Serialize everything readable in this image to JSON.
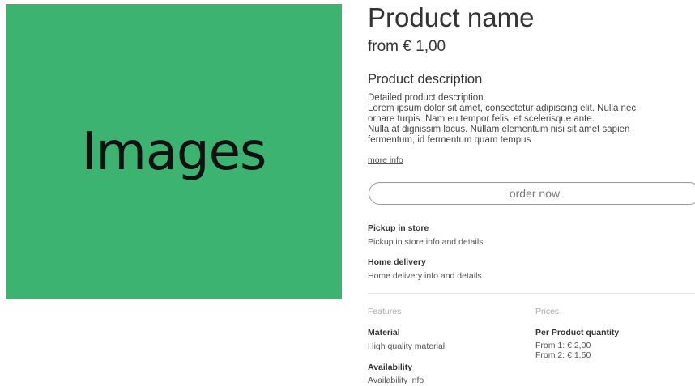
{
  "gallery": {
    "placeholder_label": "Images",
    "background_color": "#3cb371"
  },
  "product": {
    "name": "Product name",
    "price_from": "from € 1,00"
  },
  "description": {
    "title": "Product description",
    "lines": [
      "Detailed product description.",
      "Lorem ipsum dolor sit amet, consectetur adipiscing elit. Nulla nec",
      "ornare turpis. Nam eu tempor felis, et scelerisque ante.",
      "Nulla at dignissim lacus. Nullam elementum nisi sit amet sapien",
      "fermentum, id fermentum quam tempus"
    ],
    "more_info_link": "more info"
  },
  "order": {
    "button_label": "order now"
  },
  "delivery": {
    "pickup_title": "Pickup in store",
    "pickup_text": "Pickup in store info and details",
    "home_title": "Home delivery",
    "home_text": "Home delivery info and details"
  },
  "features": {
    "heading": "Features",
    "material_title": "Material",
    "material_text": "High quality material",
    "availability_title": "Availability",
    "availability_text": "Availability info"
  },
  "prices": {
    "heading": "Prices",
    "quantity_title": "Per Product quantity",
    "tiers": [
      "From 1: € 2,00",
      "From 2: € 1,50"
    ]
  }
}
